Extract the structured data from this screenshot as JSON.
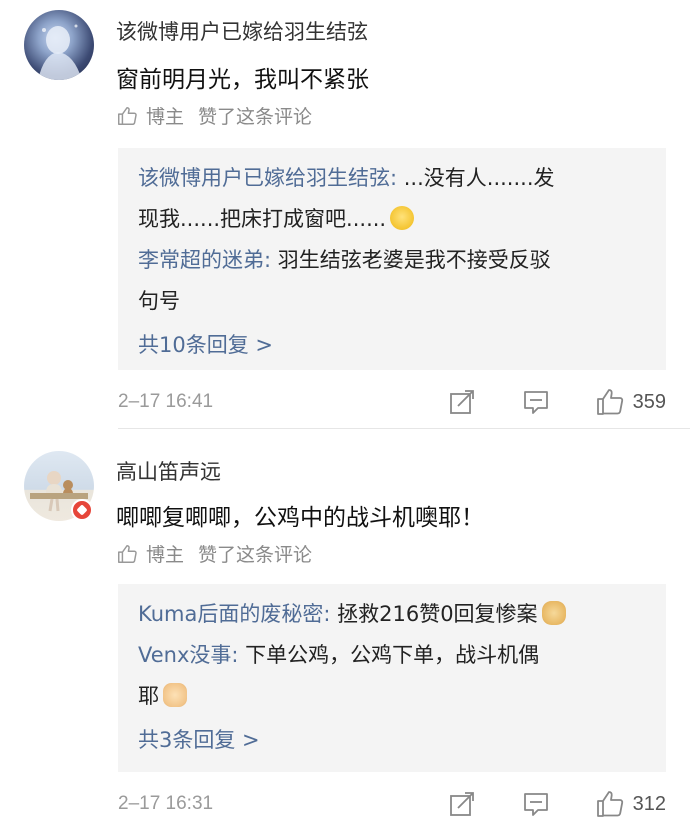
{
  "comments": [
    {
      "username": "该微博用户已嫁给羽生结弦",
      "text": "窗前明月光，我叫不紧张",
      "liked_by": "博主",
      "liked_text": "赞了这条评论",
      "replies": [
        {
          "name": "该微博用户已嫁给羽生结弦:",
          "text_line1": " ...没有人.......发",
          "text_line2": "现我......把床打成窗吧......",
          "emoji": "smile-emoji"
        },
        {
          "name": "李常超的迷弟:",
          "text_line1": " 羽生结弦老婆是我不接受反驳",
          "text_line2": "句号"
        }
      ],
      "more_replies": "共10条回复 >",
      "time": "2–17 16:41",
      "likes": "359"
    },
    {
      "username": "高山笛声远",
      "text": "唧唧复唧唧，公鸡中的战斗机噢耶！",
      "liked_by": "博主",
      "liked_text": "赞了这条评论",
      "replies": [
        {
          "name": "Kuma后面的废秘密:",
          "text_line1": " 拯救216赞0回复惨案",
          "emoji": "dog-emoji"
        },
        {
          "name": "Venx没事:",
          "text_line1": " 下单公鸡，公鸡下单，战斗机偶",
          "text_line2": "耶",
          "emoji": "peace-emoji"
        }
      ],
      "more_replies": "共3条回复 >",
      "time": "2–17 16:31",
      "likes": "312"
    }
  ],
  "colors": {
    "link": "#506c96",
    "reply_bg": "#f4f4f4",
    "verified_badge": "#e6463a"
  }
}
